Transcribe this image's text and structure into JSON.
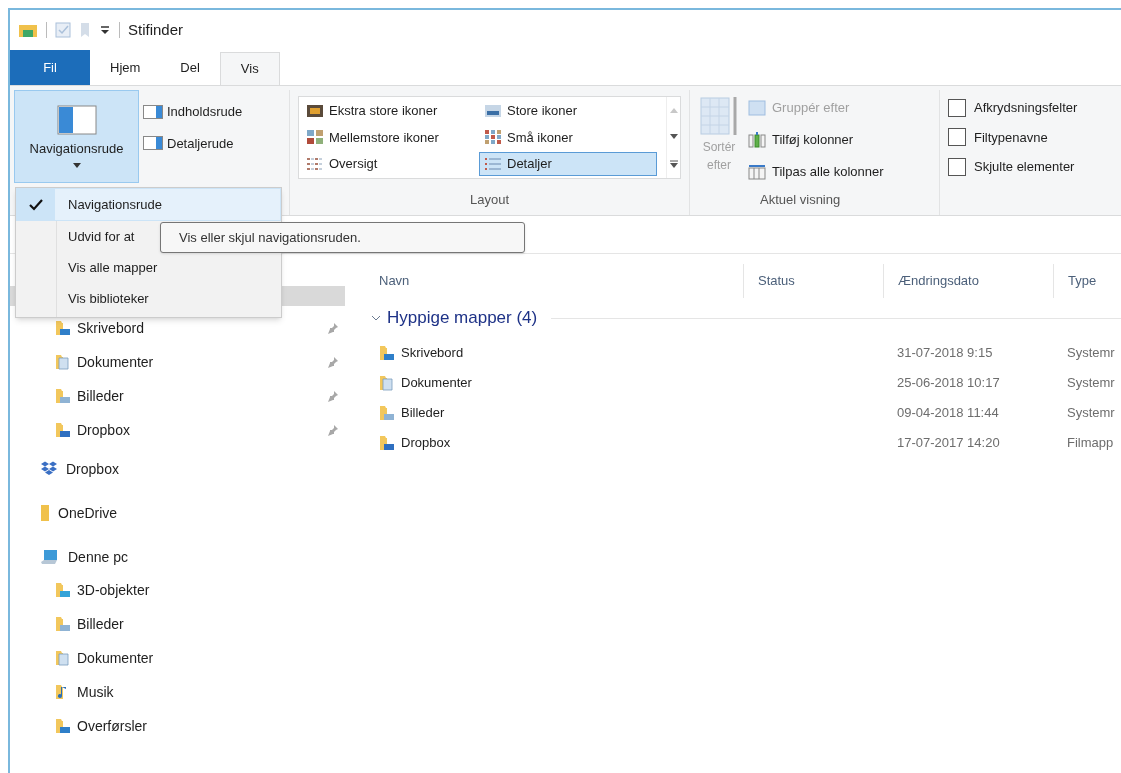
{
  "title_bar": {
    "title": "Stifinder"
  },
  "ribbon_tabs": [
    {
      "label": "Fil",
      "kind": "file",
      "selected": false
    },
    {
      "label": "Hjem",
      "kind": "tab",
      "selected": false
    },
    {
      "label": "Del",
      "kind": "tab",
      "selected": false
    },
    {
      "label": "Vis",
      "kind": "tab",
      "selected": true
    }
  ],
  "panes_group": {
    "navigation_pane_button": {
      "label": "Navigationsrude",
      "selected": true
    },
    "items": [
      "Indholdsrude",
      "Detaljerude"
    ]
  },
  "layout_group": {
    "label": "Layout",
    "options": [
      {
        "label": "Ekstra store ikoner",
        "kind": "xl",
        "selected": false
      },
      {
        "label": "Store ikoner",
        "kind": "large",
        "selected": false
      },
      {
        "label": "Mellemstore ikoner",
        "kind": "medium",
        "selected": false
      },
      {
        "label": "Små ikoner",
        "kind": "small",
        "selected": false
      },
      {
        "label": "Oversigt",
        "kind": "list",
        "selected": false
      },
      {
        "label": "Detaljer",
        "kind": "details",
        "selected": true
      }
    ]
  },
  "current_view_group": {
    "label": "Aktuel visning",
    "sort_button": {
      "label": "Sortér efter",
      "disabled": true
    },
    "commands": [
      {
        "label": "Gruppér efter",
        "kind": "group",
        "disabled": true
      },
      {
        "label": "Tilføj kolonner",
        "kind": "add",
        "disabled": false
      },
      {
        "label": "Tilpas alle kolonner",
        "kind": "fit",
        "disabled": false
      }
    ]
  },
  "show_hide_group": {
    "checkboxes": [
      {
        "label": "Afkrydsningsfelter",
        "checked": false
      },
      {
        "label": "Filtypenavne",
        "checked": false
      },
      {
        "label": "Skjulte elementer",
        "checked": false
      }
    ]
  },
  "dropdown_menu": {
    "items": [
      {
        "label": "Navigationsrude",
        "checked": true
      },
      {
        "label": "Udvid for at",
        "checked": false
      },
      {
        "label": "Vis alle mapper",
        "checked": false
      },
      {
        "label": "Vis biblioteker",
        "checked": false
      }
    ]
  },
  "tooltip": {
    "text": "Vis eller skjul navigationsruden."
  },
  "navigation_pane": {
    "quick_access": [
      {
        "label": "Skrivebord",
        "kind": "desktop",
        "pinned": true
      },
      {
        "label": "Dokumenter",
        "kind": "documents",
        "pinned": true
      },
      {
        "label": "Billeder",
        "kind": "pictures",
        "pinned": true
      },
      {
        "label": "Dropbox",
        "kind": "dropbox",
        "pinned": true
      }
    ],
    "roots": [
      {
        "label": "Dropbox",
        "kind": "dropbox-root"
      },
      {
        "label": "OneDrive",
        "kind": "plain"
      },
      {
        "label": "Denne pc",
        "kind": "computer",
        "children": [
          {
            "label": "3D-objekter",
            "kind": "objects3d"
          },
          {
            "label": "Billeder",
            "kind": "pictures"
          },
          {
            "label": "Dokumenter",
            "kind": "documents"
          },
          {
            "label": "Musik",
            "kind": "music"
          },
          {
            "label": "Overførsler",
            "kind": "downloads"
          }
        ]
      }
    ]
  },
  "file_list": {
    "columns": [
      "Navn",
      "Status",
      "Ændringsdato",
      "Type"
    ],
    "group": {
      "label": "Hyppige mapper (4)",
      "expanded": true
    },
    "rows": [
      {
        "name": "Skrivebord",
        "kind": "desktop",
        "date": "31-07-2018 9:15",
        "type": "Systemr"
      },
      {
        "name": "Dokumenter",
        "kind": "documents",
        "date": "25-06-2018 10:17",
        "type": "Systemr"
      },
      {
        "name": "Billeder",
        "kind": "pictures",
        "date": "09-04-2018 11:44",
        "type": "Systemr"
      },
      {
        "name": "Dropbox",
        "kind": "dropbox",
        "date": "17-07-2017 14:20",
        "type": "Filmapp"
      }
    ]
  }
}
